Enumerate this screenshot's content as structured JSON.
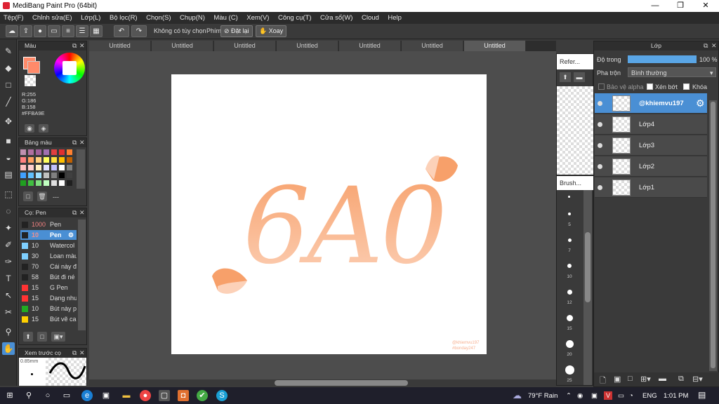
{
  "window": {
    "title": "MediBang Paint Pro (64bit)"
  },
  "menu": [
    "Tệp(F)",
    "Chỉnh sửa(E)",
    "Lớp(L)",
    "Bộ lọc(R)",
    "Chọn(S)",
    "Chụp(N)",
    "Màu (C)",
    "Xem(V)",
    "Công cụ(T)",
    "Cửa sổ(W)",
    "Cloud",
    "Help"
  ],
  "toolbar": {
    "option_label": "Không có tùy chọn",
    "key_label": "Phím",
    "reset_label": "Đặt lại",
    "rotate_label": "Xoay"
  },
  "color_panel": {
    "title": "Màu",
    "r": "R:255",
    "g": "G:186",
    "b": "B:158",
    "hex": "#FFBA9E",
    "primary_color": "#FF8A6A"
  },
  "palette_panel": {
    "title": "Bảng màu",
    "dash": "---"
  },
  "brush_panel": {
    "title": "Cọ: Pen",
    "items": [
      {
        "size": "1000",
        "name": "Pen",
        "color": "#222222"
      },
      {
        "size": "10",
        "name": "Pen",
        "color": "#222222"
      },
      {
        "size": "10",
        "name": "Watercol",
        "color": "#7fd0ff"
      },
      {
        "size": "30",
        "name": "Loan màu",
        "color": "#7fd0ff"
      },
      {
        "size": "70",
        "name": "Cái này đ",
        "color": "#222222"
      },
      {
        "size": "58",
        "name": "Bút đi né",
        "color": "#222222"
      },
      {
        "size": "15",
        "name": "G Pen",
        "color": "#ff3333"
      },
      {
        "size": "15",
        "name": "Dạng nhu",
        "color": "#ff3333"
      },
      {
        "size": "10",
        "name": "Bút này p",
        "color": "#22aa22"
      },
      {
        "size": "15",
        "name": "Bút vẽ ca",
        "color": "#ffd000"
      }
    ]
  },
  "preview_panel": {
    "title": "Xem trước cọ",
    "size": "0.85mm"
  },
  "tabs": [
    "Untitled",
    "Untitled",
    "Untitled",
    "Untitled",
    "Untitled",
    "Untitled",
    "Untitled"
  ],
  "canvas": {
    "art_text": "6A0",
    "watermark_1": "@khiemvu197",
    "watermark_2": "#bonday247"
  },
  "reference_panel": {
    "title": "Refer..."
  },
  "brush_size_panel": {
    "title": "Brush...",
    "sizes": [
      "5",
      "7",
      "10",
      "12",
      "15",
      "20",
      "25"
    ]
  },
  "layer_panel": {
    "title": "Lớp",
    "opacity_label": "Độ trong",
    "opacity_value": "100 %",
    "opacity_fraction": 1.0,
    "blend_label": "Pha trộn",
    "blend_value": "Bình thường",
    "protect_alpha": "Bảo vệ alpha",
    "clipping": "Xén bớt",
    "lock": "Khóa",
    "layers": [
      "@khiemvu197",
      "Lớp4",
      "Lớp3",
      "Lớp2",
      "Lớp1"
    ]
  },
  "taskbar": {
    "weather": "79°F  Rain",
    "lang": "ENG",
    "time": "1:01 PM"
  }
}
